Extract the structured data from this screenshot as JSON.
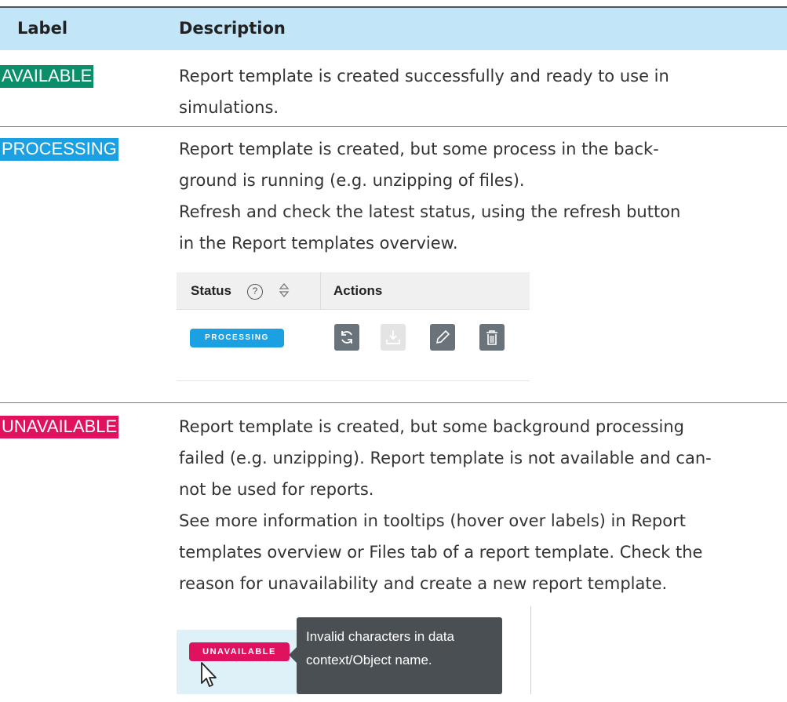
{
  "header": {
    "label": "Label",
    "description": "Description"
  },
  "rows": [
    {
      "status": "AVAILABLE",
      "status_color": "#0a8f6a",
      "lines": [
        "Report template is created successfully and ready to use in",
        "simulations."
      ]
    },
    {
      "status": "PROCESSING",
      "status_color": "#1ba1e2",
      "lines": [
        "Report template is created, but some process in the back-",
        "ground is running (e.g. unzipping of files).",
        "Refresh and check the latest status, using the refresh button",
        "in the Report templates overview."
      ]
    },
    {
      "status": "UNAVAILABLE",
      "status_color": "#e0115f",
      "lines": [
        "Report template is created, but some background processing",
        "failed (e.g. unzipping). Report template is not available and can-",
        "not be used for reports.",
        "See more information in tooltips (hover over labels) in Report",
        "templates overview or Files tab of a report template. Check the",
        "reason for unavailability and create a new report template."
      ]
    }
  ],
  "screenshot_actions": {
    "status_header": "Status",
    "help_glyph": "?",
    "actions_header": "Actions",
    "badge": "PROCESSING",
    "icons": [
      "refresh-icon",
      "download-icon",
      "edit-icon",
      "delete-icon"
    ]
  },
  "screenshot_tooltip": {
    "badge": "UNAVAILABLE",
    "tooltip_lines": [
      "Invalid characters in data",
      "context/Object name."
    ]
  }
}
